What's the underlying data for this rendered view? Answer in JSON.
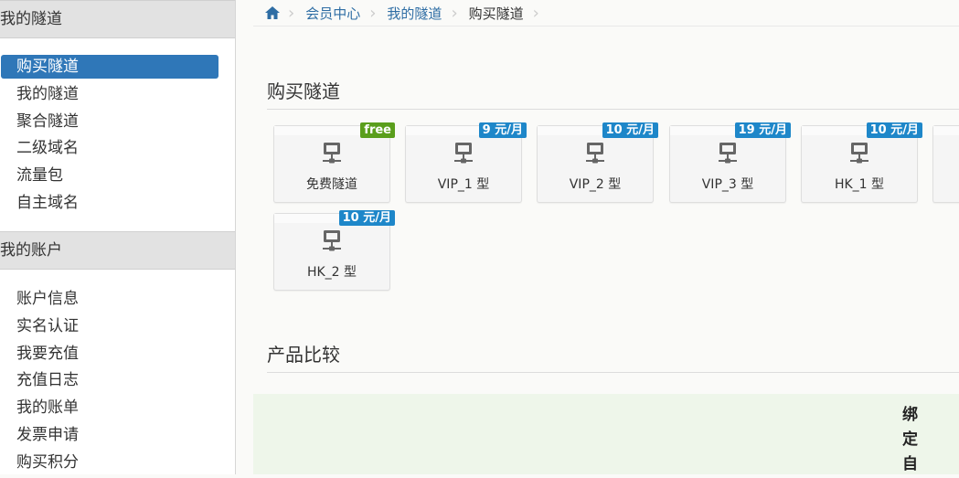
{
  "sidebar": {
    "sections": [
      {
        "title": "我的隧道",
        "items": [
          {
            "label": "购买隧道",
            "active": true
          },
          {
            "label": "我的隧道"
          },
          {
            "label": "聚合隧道"
          },
          {
            "label": "二级域名"
          },
          {
            "label": "流量包"
          },
          {
            "label": "自主域名"
          }
        ]
      },
      {
        "title": "我的账户",
        "items": [
          {
            "label": "账户信息"
          },
          {
            "label": "实名认证"
          },
          {
            "label": "我要充值"
          },
          {
            "label": "充值日志"
          },
          {
            "label": "我的账单"
          },
          {
            "label": "发票申请"
          },
          {
            "label": "购买积分"
          }
        ]
      }
    ]
  },
  "breadcrumb": [
    "会员中心",
    "我的隧道",
    "购买隧道"
  ],
  "main": {
    "buy_title": "购买隧道",
    "compare_title": "产品比较",
    "compare_column_chars": [
      "绑",
      "定",
      "自"
    ]
  },
  "plans": [
    {
      "name": "免费隧道",
      "price": "free",
      "free": true,
      "icon": "monitor-network-icon"
    },
    {
      "name": "VIP_1 型",
      "price": "9 元/月",
      "icon": "monitor-network-icon"
    },
    {
      "name": "VIP_2 型",
      "price": "10 元/月",
      "icon": "monitor-network-icon"
    },
    {
      "name": "VIP_3 型",
      "price": "19 元/月",
      "icon": "monitor-network-icon"
    },
    {
      "name": "HK_1 型",
      "price": "10 元/月",
      "icon": "monitor-network-icon"
    },
    {
      "name": "HK_2 型",
      "price": "10 元/月",
      "icon": "monitor-network-icon"
    }
  ],
  "colors": {
    "active_nav": "#2f77b8",
    "link": "#2e6da4",
    "badge_price": "#1e87c9",
    "badge_free": "#5a9e1c",
    "compare_bg": "#eef6ea"
  }
}
